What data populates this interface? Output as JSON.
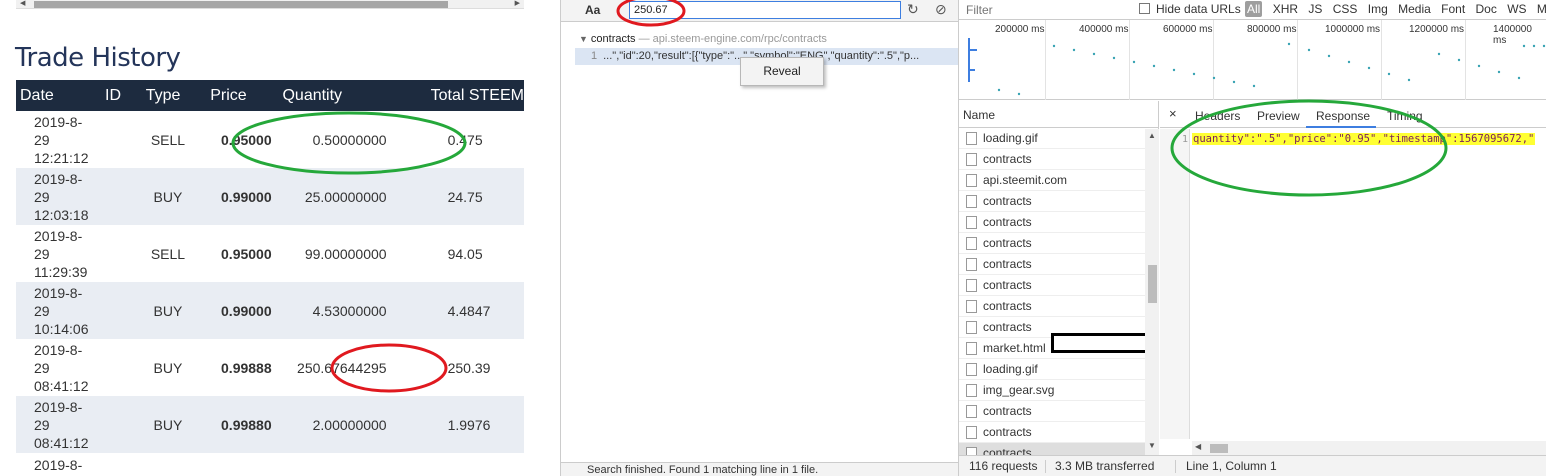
{
  "trade_history": {
    "title": "Trade History",
    "columns": [
      "Date",
      "ID",
      "Type",
      "Price",
      "Quantity",
      "Total STEEM"
    ],
    "rows": [
      {
        "date_l1": "2019-8-",
        "date_l2": "29",
        "date_l3": "12:21:12",
        "id": "",
        "type": "SELL",
        "price": "0.95000",
        "quantity": "0.50000000",
        "total": "0.475"
      },
      {
        "date_l1": "2019-8-",
        "date_l2": "29",
        "date_l3": "12:03:18",
        "id": "",
        "type": "BUY",
        "price": "0.99000",
        "quantity": "25.00000000",
        "total": "24.75"
      },
      {
        "date_l1": "2019-8-",
        "date_l2": "29",
        "date_l3": "11:29:39",
        "id": "",
        "type": "SELL",
        "price": "0.95000",
        "quantity": "99.00000000",
        "total": "94.05"
      },
      {
        "date_l1": "2019-8-",
        "date_l2": "29",
        "date_l3": "10:14:06",
        "id": "",
        "type": "BUY",
        "price": "0.99000",
        "quantity": "4.53000000",
        "total": "4.4847"
      },
      {
        "date_l1": "2019-8-",
        "date_l2": "29",
        "date_l3": "08:41:12",
        "id": "",
        "type": "BUY",
        "price": "0.99888",
        "quantity": "250.67644295",
        "total": "250.39"
      },
      {
        "date_l1": "2019-8-",
        "date_l2": "29",
        "date_l3": "08:41:12",
        "id": "",
        "type": "BUY",
        "price": "0.99880",
        "quantity": "2.00000000",
        "total": "1.9976"
      }
    ],
    "partial_row_date": "2019-8-"
  },
  "search_panel": {
    "case_toggle": "Aa",
    "dot": "·",
    "query": "250.67",
    "refresh_icon": "refresh-icon",
    "clear_icon": "clear-icon",
    "result_file": "contracts",
    "result_source": "— api.steem-engine.com/rpc/contracts",
    "result_line_no": "1",
    "result_line": "...\",\"id\":20,\"result\":[{\"type\":\"...\",\"symbol\":\"ENG\",\"quantity\":\".5\",\"p...",
    "context_menu_item": "Reveal",
    "status": "Search finished.  Found 1 matching line in 1 file."
  },
  "network": {
    "filter_placeholder": "Filter",
    "hide_data_urls": "Hide data URLs",
    "type_filters": [
      "All",
      "XHR",
      "JS",
      "CSS",
      "Img",
      "Media",
      "Font",
      "Doc",
      "WS",
      "Manifest"
    ],
    "timeline_ticks": [
      "200000 ms",
      "400000 ms",
      "600000 ms",
      "800000 ms",
      "1000000 ms",
      "1200000 ms",
      "1400000 ms"
    ],
    "name_header": "Name",
    "requests": [
      {
        "name": "loading.gif",
        "icon": "gif"
      },
      {
        "name": "contracts",
        "icon": "doc"
      },
      {
        "name": "api.steemit.com",
        "icon": "doc"
      },
      {
        "name": "contracts",
        "icon": "doc"
      },
      {
        "name": "contracts",
        "icon": "doc"
      },
      {
        "name": "contracts",
        "icon": "doc"
      },
      {
        "name": "contracts",
        "icon": "doc"
      },
      {
        "name": "contracts",
        "icon": "doc"
      },
      {
        "name": "contracts",
        "icon": "doc"
      },
      {
        "name": "contracts",
        "icon": "doc"
      },
      {
        "name": "market.html",
        "icon": "doc"
      },
      {
        "name": "loading.gif",
        "icon": "gif"
      },
      {
        "name": "img_gear.svg",
        "icon": "doc"
      },
      {
        "name": "contracts",
        "icon": "doc"
      },
      {
        "name": "contracts",
        "icon": "doc"
      },
      {
        "name": "contracts",
        "icon": "doc"
      }
    ],
    "detail_tabs": {
      "close": "×",
      "headers": "Headers",
      "preview": "Preview",
      "response": "Response",
      "timing": "Timing"
    },
    "response_line_no": "1",
    "response_text": "quantity\":\".5\",\"price\":\"0.95\",\"timestamp\":1567095672,\"",
    "status_requests": "116 requests",
    "status_transferred": "3.3 MB transferred",
    "status_cursor": "Line 1, Column 1"
  },
  "colors": {
    "header_bg": "#1d2b3f",
    "sell": "#c62828",
    "buy": "#4a9a2e",
    "annotation_red": "#e0191f",
    "annotation_green": "#25a83a",
    "highlight": "#ffff33"
  }
}
